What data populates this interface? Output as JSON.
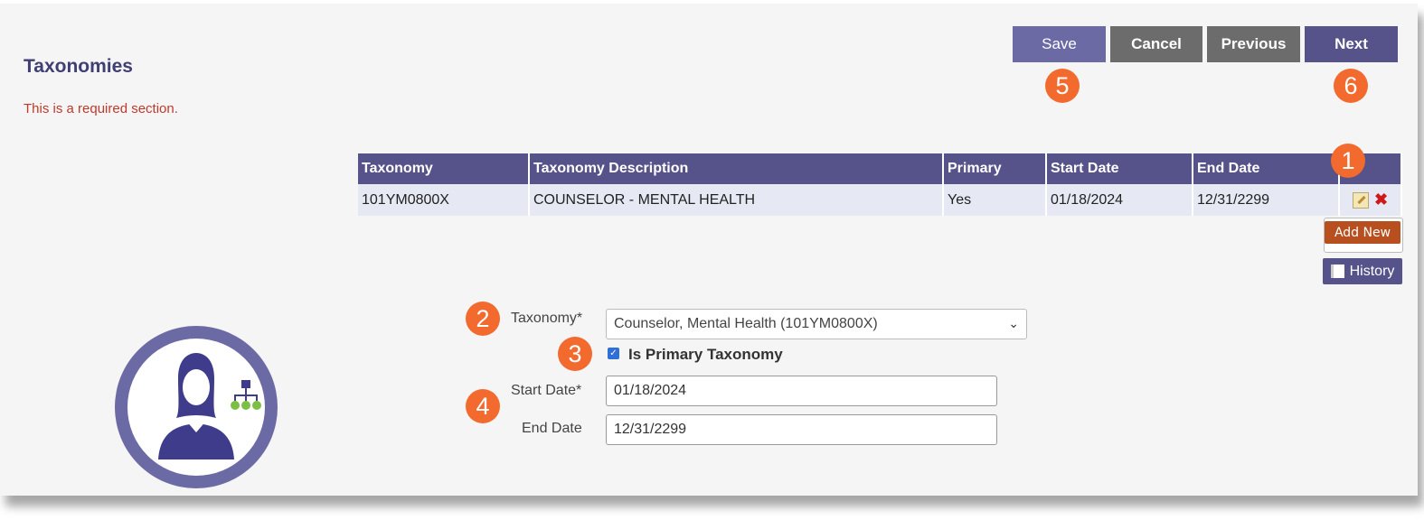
{
  "header": {
    "title": "Taxonomies",
    "required_note": "This is a required section."
  },
  "toolbar": {
    "save_label": "Save",
    "cancel_label": "Cancel",
    "previous_label": "Previous",
    "next_label": "Next"
  },
  "callouts": {
    "c1": "1",
    "c2": "2",
    "c3": "3",
    "c4": "4",
    "c5": "5",
    "c6": "6"
  },
  "table": {
    "headers": [
      "Taxonomy",
      "Taxonomy Description",
      "Primary",
      "Start Date",
      "End Date",
      ""
    ],
    "rows": [
      {
        "taxonomy": "101YM0800X",
        "description": "COUNSELOR - MENTAL HEALTH",
        "primary": "Yes",
        "start_date": "01/18/2024",
        "end_date": "12/31/2299"
      }
    ]
  },
  "actions": {
    "add_new_label": "Add New",
    "history_label": "History"
  },
  "form": {
    "taxonomy_label": "Taxonomy*",
    "taxonomy_value": "Counselor, Mental Health (101YM0800X)",
    "primary_label": "Is Primary Taxonomy",
    "primary_checked": true,
    "start_date_label": "Start Date*",
    "start_date_value": "01/18/2024",
    "end_date_label": "End Date",
    "end_date_value": "12/31/2299"
  },
  "colors": {
    "accent": "#56528a",
    "callout": "#f26a2e",
    "required": "#c0392b",
    "add_new": "#b84f1e"
  },
  "icons": {
    "edit": "edit-icon",
    "delete": "delete-icon",
    "history": "document-icon",
    "select": "chevron-down-icon",
    "avatar": "provider-avatar-icon"
  }
}
